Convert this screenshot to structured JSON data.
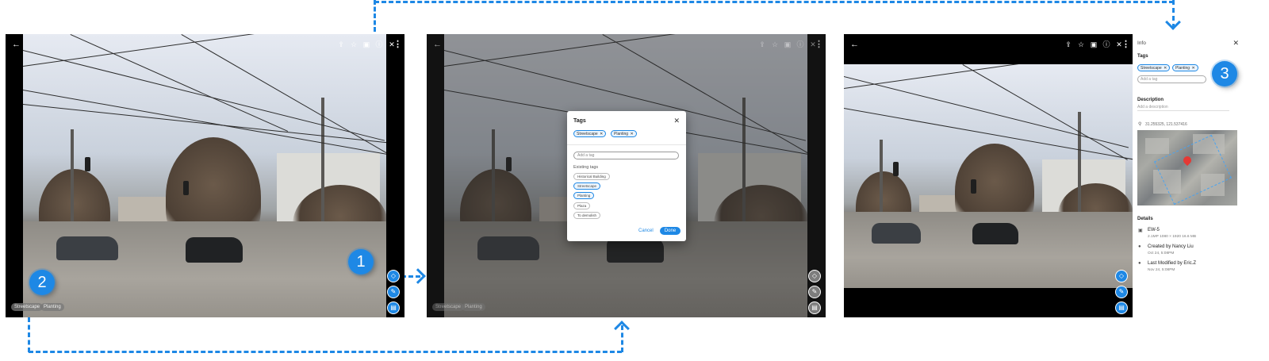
{
  "flow": {
    "steps": [
      "1",
      "2",
      "3"
    ],
    "accent_color": "#1e88e5"
  },
  "viewer": {
    "back_icon": "arrow-left-icon",
    "more_icon": "more-vertical-icon",
    "top_icons": [
      "share-icon",
      "star-icon",
      "gallery-icon",
      "info-icon",
      "trash-icon"
    ],
    "fab_icons": [
      "tag-icon",
      "edit-icon",
      "image-icon"
    ],
    "photo_tags": [
      "Streetscape",
      "Planting"
    ]
  },
  "dialog": {
    "title": "Tags",
    "close_icon": "close-icon",
    "selected_tags": [
      "Streetscape",
      "Planting"
    ],
    "add_placeholder": "Add a tag",
    "existing_label": "Existing tags",
    "existing_tags": [
      "Historical Building",
      "Streetscape",
      "Planting",
      "Plaza",
      "To demolish"
    ],
    "cancel_label": "Cancel",
    "done_label": "Done"
  },
  "info": {
    "title": "Info",
    "tags_label": "Tags",
    "tags": [
      "Streetscape",
      "Planting"
    ],
    "add_tag_placeholder": "Add a tag",
    "description_label": "Description",
    "description_placeholder": "Add a description",
    "location": "31.255325, 121.537416",
    "details_label": "Details",
    "file_name": "EW-5",
    "file_meta": "2.1MP 1080 × 1920 16.6 MB",
    "created_by": "Created by Nancy Liu",
    "created_date": "Oct 24, 5:08PM",
    "modified_by": "Last Modified by Eric.Z",
    "modified_date": "Nov 24, 5:08PM"
  }
}
